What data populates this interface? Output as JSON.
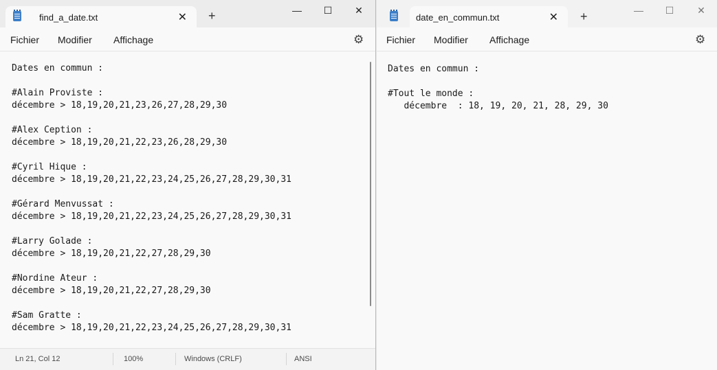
{
  "left_window": {
    "tab_title": "find_a_date.txt",
    "tab_close": "✕",
    "new_tab": "+",
    "controls": {
      "minimize": "—",
      "maximize": "☐",
      "close": "✕"
    },
    "menu": [
      "Fichier",
      "Modifier",
      "Affichage"
    ],
    "content": "Dates en commun :\n\n#Alain Proviste :\ndécembre > 18,19,20,21,23,26,27,28,29,30\n\n#Alex Ception :\ndécembre > 18,19,20,21,22,23,26,28,29,30\n\n#Cyril Hique :\ndécembre > 18,19,20,21,22,23,24,25,26,27,28,29,30,31\n\n#Gérard Menvussat :\ndécembre > 18,19,20,21,22,23,24,25,26,27,28,29,30,31\n\n#Larry Golade :\ndécembre > 18,19,20,21,22,27,28,29,30\n\n#Nordine Ateur :\ndécembre > 18,19,20,21,22,27,28,29,30\n\n#Sam Gratte :\ndécembre > 18,19,20,21,22,23,24,25,26,27,28,29,30,31",
    "status": {
      "position": "Ln 21, Col 12",
      "zoom": "100%",
      "line_ending": "Windows (CRLF)",
      "encoding": "ANSI"
    }
  },
  "right_window": {
    "tab_title": "date_en_commun.txt",
    "tab_close": "✕",
    "new_tab": "+",
    "controls": {
      "minimize": "—",
      "maximize": "☐",
      "close": "✕"
    },
    "menu": [
      "Fichier",
      "Modifier",
      "Affichage"
    ],
    "content": "Dates en commun :\n\n#Tout le monde :\n   décembre  : 18, 19, 20, 21, 28, 29, 30"
  },
  "icons": {
    "app": "notepad-icon",
    "settings": "gear-icon"
  }
}
